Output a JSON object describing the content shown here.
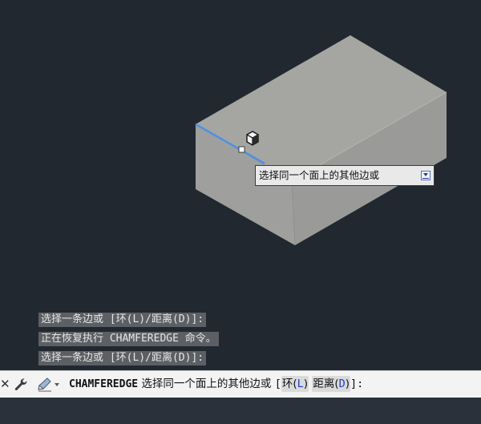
{
  "viewport": {
    "background": "#212830",
    "box_colors": {
      "top": "#a5a6a2",
      "left": "#9fa09d",
      "right": "#9a9b98"
    },
    "highlight_edge_color": "#4f8fe8"
  },
  "cursor": {
    "icon": "3d-box-cursor-icon"
  },
  "tooltip": {
    "text": "选择同一个面上的其他边或",
    "arrow_icon": "down-arrow-icon"
  },
  "command_history": [
    "选择一条边或 [环(L)/距离(D)]:",
    "正在恢复执行 CHAMFEREDGE 命令。",
    "选择一条边或 [环(L)/距离(D)]:"
  ],
  "command_line": {
    "close_icon": "close-icon",
    "customize_icon": "wrench-icon",
    "recent_icon": "pencil-icon",
    "command_name": "CHAMFEREDGE",
    "prompt": "选择同一个面上的其他边或",
    "bracket_open": "[",
    "bracket_close": "]:",
    "options": [
      {
        "label": "环(",
        "key": "L",
        "close": ")"
      },
      {
        "label": "距离(",
        "key": "D",
        "close": ")"
      }
    ],
    "option_key_color": "#1a3fc4"
  }
}
